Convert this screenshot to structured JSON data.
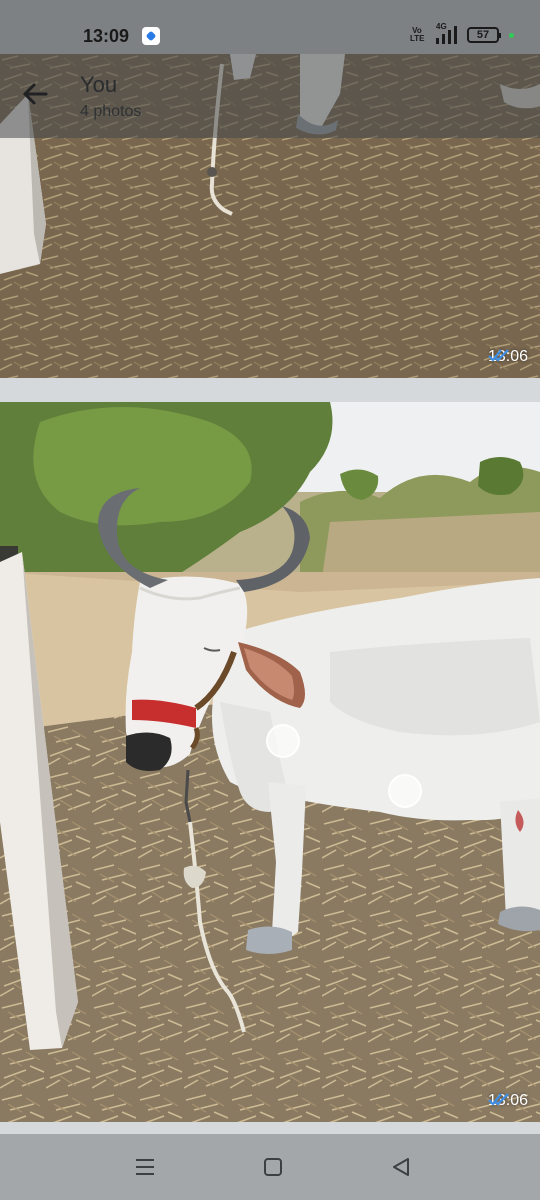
{
  "status_bar": {
    "time": "13:09",
    "volte": "Vo LTE",
    "network": "4G",
    "battery": "57"
  },
  "header": {
    "title": "You",
    "subtitle": "4 photos"
  },
  "photos": [
    {
      "time": "13:06",
      "status_icon": "double-check-icon"
    },
    {
      "time": "13:06",
      "status_icon": "double-check-icon"
    }
  ],
  "nav": {
    "recent": "menu-icon",
    "home": "home-icon",
    "back": "back-triangle-icon"
  },
  "colors": {
    "status_bar": "#7d8184",
    "tick_blue": "#3b8fe8",
    "nav_bar": "#a4a7aa"
  }
}
